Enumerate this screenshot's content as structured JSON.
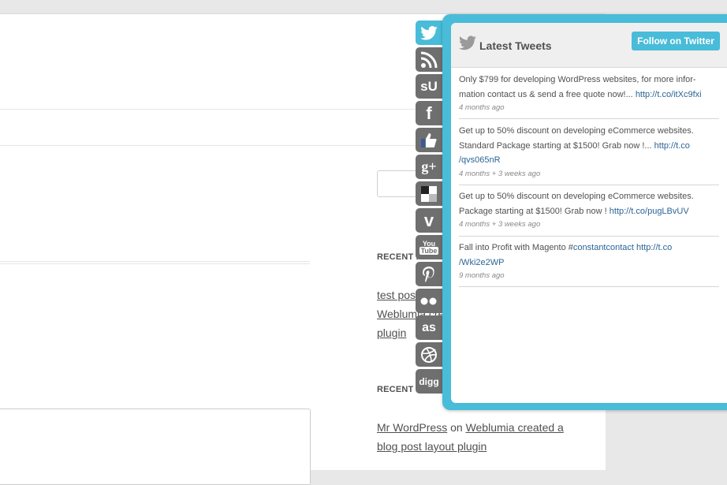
{
  "sidebar": {
    "recent_posts_title": "RECENT POSTS",
    "recent_posts": [
      "test post",
      "Weblumia created a blog post layout",
      "plugin"
    ],
    "recent_comments_title": "RECENT COMMENTS",
    "recent_comment": {
      "author": "Mr WordPress",
      "connector": " on ",
      "post": "Weblumia created a blog post layout plugin"
    }
  },
  "social_tabs": [
    {
      "name": "twitter",
      "icon": "twitter-icon",
      "active": true
    },
    {
      "name": "rss",
      "icon": "rss-icon"
    },
    {
      "name": "stumbleupon",
      "icon": "stumbleupon-icon"
    },
    {
      "name": "facebook",
      "icon": "facebook-icon"
    },
    {
      "name": "like",
      "icon": "thumbs-up-icon"
    },
    {
      "name": "google-plus",
      "icon": "google-plus-icon"
    },
    {
      "name": "delicious",
      "icon": "delicious-icon"
    },
    {
      "name": "vimeo",
      "icon": "vimeo-icon"
    },
    {
      "name": "youtube",
      "icon": "youtube-icon"
    },
    {
      "name": "pinterest",
      "icon": "pinterest-icon"
    },
    {
      "name": "flickr",
      "icon": "flickr-icon"
    },
    {
      "name": "lastfm",
      "icon": "lastfm-icon"
    },
    {
      "name": "dribbble",
      "icon": "dribbble-icon"
    },
    {
      "name": "digg",
      "icon": "digg-icon"
    }
  ],
  "twitter_panel": {
    "title": "Latest Tweets",
    "follow_label": "Follow on Twitter",
    "accent_color": "#48bcd8",
    "tweets": [
      {
        "lines": [
          "Only $799 for developing WordPress websites, for more infor-",
          "mation contact us & send a free quote now!... "
        ],
        "link": "http://t.co/itXc9fxi",
        "time": "4 months ago"
      },
      {
        "lines": [
          "Get up to 50% discount on developing eCommerce websites.",
          "Standard Package starting at $1500! Grab now !... "
        ],
        "link": "http://t.co/qvs065nR",
        "link_lines": [
          "http://t.co",
          "/qvs065nR"
        ],
        "time": "4 months + 3 weeks ago"
      },
      {
        "lines": [
          "Get up to 50% discount on developing eCommerce websites.",
          "Package starting at $1500! Grab now ! "
        ],
        "link": "http://t.co/pugLBvUV",
        "time": "4 months + 3 weeks ago"
      },
      {
        "lines": [
          "Fall into Profit with Magento #"
        ],
        "hashtag": "constantcontact",
        "link": "http://t.co/Wki2e2WP",
        "link_lines": [
          "http://t.co",
          "/Wki2e2WP"
        ],
        "time": "9 months ago"
      }
    ]
  }
}
